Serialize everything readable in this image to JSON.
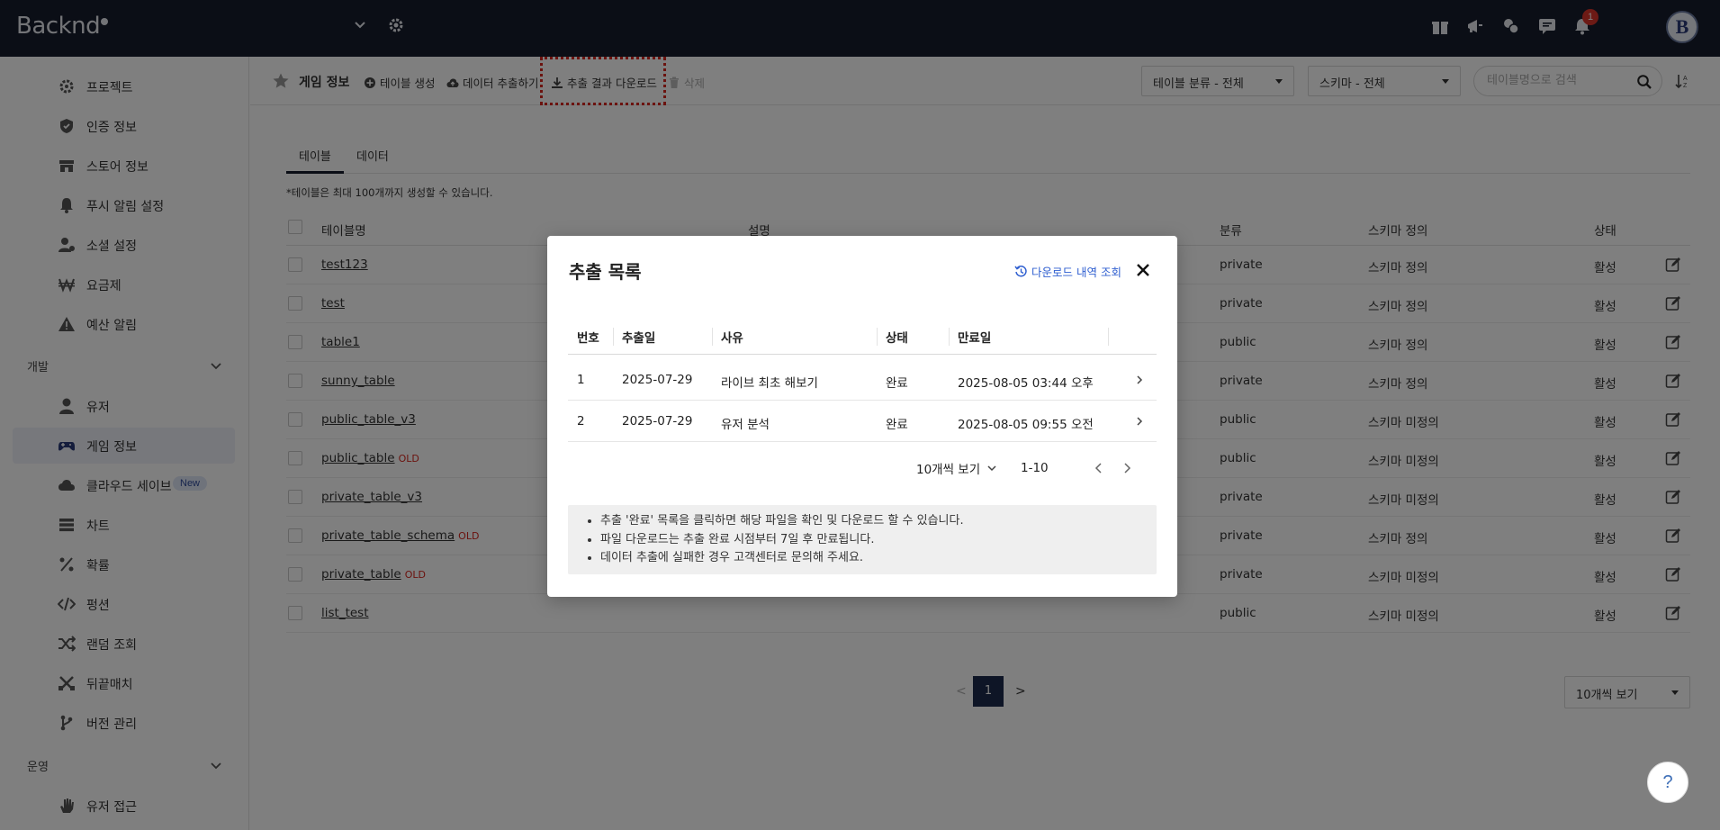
{
  "topbar": {
    "logo": "Backnd",
    "notification_count": "1",
    "avatar_letter": "B"
  },
  "sidebar": {
    "items": [
      {
        "label": "프로젝트",
        "icon": "gear-icon"
      },
      {
        "label": "인증 정보",
        "icon": "shield-icon"
      },
      {
        "label": "스토어 정보",
        "icon": "store-icon"
      },
      {
        "label": "푸시 알림 설정",
        "icon": "bell-icon"
      },
      {
        "label": "소셜 설정",
        "icon": "social-icon"
      },
      {
        "label": "요금제",
        "icon": "won-icon"
      },
      {
        "label": "예산 알림",
        "icon": "warning-icon"
      }
    ],
    "group_dev": "개발",
    "dev_items": [
      {
        "label": "유저",
        "icon": "user-icon"
      },
      {
        "label": "게임 정보",
        "icon": "gamepad-icon"
      },
      {
        "label": "클라우드 세이브",
        "icon": "cloud-icon",
        "badge": "New"
      },
      {
        "label": "차트",
        "icon": "list-icon"
      },
      {
        "label": "확률",
        "icon": "percent-icon"
      },
      {
        "label": "펑션",
        "icon": "code-icon"
      },
      {
        "label": "랜덤 조회",
        "icon": "shuffle-icon"
      },
      {
        "label": "뒤끝매치",
        "icon": "match-icon"
      },
      {
        "label": "버전 관리",
        "icon": "branch-icon"
      }
    ],
    "group_ops": "운영",
    "ops_items": [
      {
        "label": "유저 접근",
        "icon": "hand-icon"
      }
    ]
  },
  "toolbar": {
    "title": "게임 정보",
    "create_table": "테이블 생성",
    "extract_data": "데이터 추출하기",
    "download_result": "추출 결과 다운로드",
    "delete": "삭제",
    "filter_category": "테이블 분류 - 전체",
    "filter_schema": "스키마 - 전체",
    "search_placeholder": "테이블명으로 검색"
  },
  "tabs": [
    "테이블",
    "데이터"
  ],
  "note": "*테이블은 최대 100개까지 생성할 수 있습니다.",
  "table": {
    "headers": {
      "name": "테이블명",
      "desc": "설명",
      "category": "분류",
      "schema": "스키마 정의",
      "status": "상태"
    },
    "rows": [
      {
        "name": "test123",
        "old": "",
        "category": "private",
        "schema": "스키마 정의",
        "status": "활성"
      },
      {
        "name": "test",
        "old": "",
        "category": "private",
        "schema": "스키마 정의",
        "status": "활성"
      },
      {
        "name": "table1",
        "old": "",
        "category": "public",
        "schema": "스키마 정의",
        "status": "활성"
      },
      {
        "name": "sunny_table",
        "old": "",
        "category": "private",
        "schema": "스키마 정의",
        "status": "활성"
      },
      {
        "name": "public_table_v3",
        "old": "",
        "category": "public",
        "schema": "스키마 미정의",
        "status": "활성"
      },
      {
        "name": "public_table",
        "old": "OLD",
        "category": "public",
        "schema": "스키마 미정의",
        "status": "활성"
      },
      {
        "name": "private_table_v3",
        "old": "",
        "category": "private",
        "schema": "스키마 미정의",
        "status": "활성"
      },
      {
        "name": "private_table_schema",
        "old": "OLD",
        "category": "private",
        "schema": "스키마 정의",
        "status": "활성"
      },
      {
        "name": "private_table",
        "old": "OLD",
        "category": "private",
        "schema": "스키마 미정의",
        "status": "활성"
      },
      {
        "name": "list_test",
        "old": "",
        "category": "public",
        "schema": "스키마 미정의",
        "status": "활성"
      }
    ]
  },
  "pagination": {
    "prev": "<",
    "current": "1",
    "next": ">",
    "page_size": "10개씩 보기"
  },
  "help": "?",
  "modal": {
    "title": "추출 목록",
    "history_link": "다운로드 내역 조회",
    "headers": {
      "no": "번호",
      "date": "추출일",
      "reason": "사유",
      "status": "상태",
      "expire": "만료일"
    },
    "rows": [
      {
        "no": "1",
        "date": "2025-07-29",
        "reason": "라이브 최초 해보기",
        "status": "완료",
        "expire": "2025-08-05 03:44 오후"
      },
      {
        "no": "2",
        "date": "2025-07-29",
        "reason": "유저 분석",
        "status": "완료",
        "expire": "2025-08-05 09:55 오전"
      }
    ],
    "page_size": "10개씩 보기",
    "range": "1-10",
    "info": [
      "추출 '완료' 목록을 클릭하면 해당 파일을 확인 및 다운로드 할 수 있습니다.",
      "파일 다운로드는 추출 완료 시점부터 7일 후 만료됩니다.",
      "데이터 추출에 실패한 경우 고객센터로 문의해 주세요."
    ]
  }
}
